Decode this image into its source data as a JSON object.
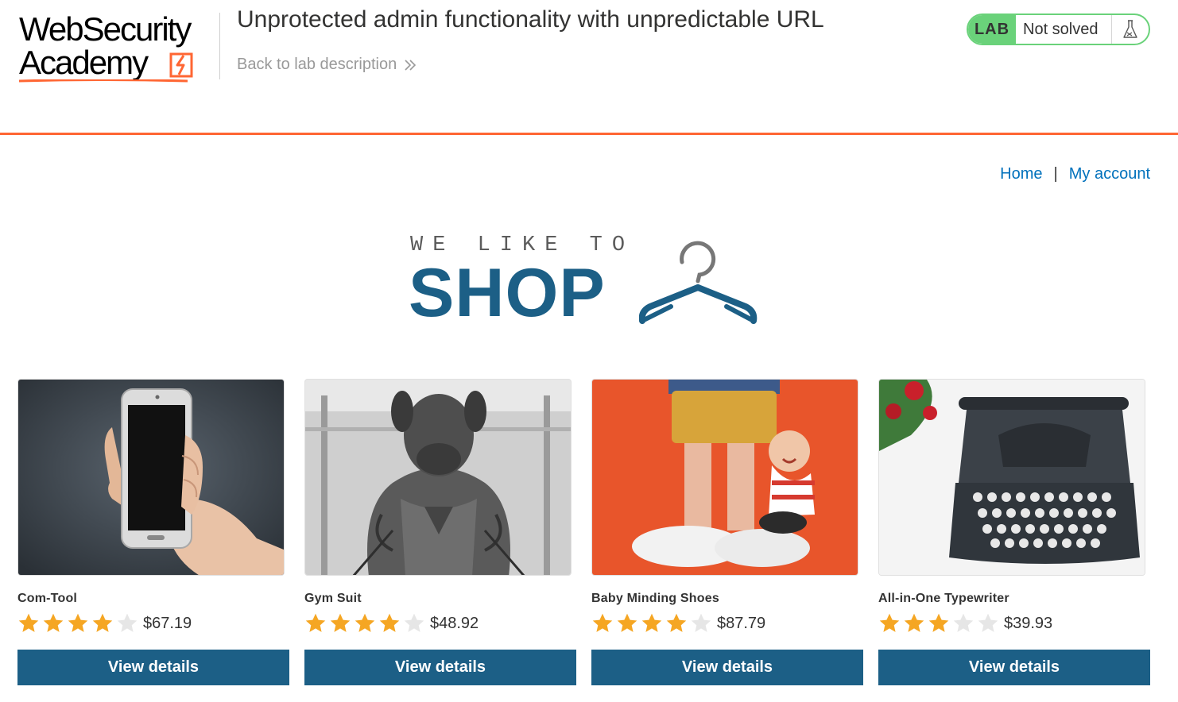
{
  "brand": {
    "line1": "WebSecurity",
    "line2": "Academy",
    "accent_color": "#ff6633"
  },
  "lab": {
    "title": "Unprotected admin functionality with unpredictable URL",
    "back_link": "Back to lab description",
    "tag": "LAB",
    "status": "Not solved",
    "status_color": "#6ad27a",
    "flask_icon": "flask-icon"
  },
  "nav": {
    "home": "Home",
    "separator": "|",
    "my_account": "My account"
  },
  "banner": {
    "small_text": "WE LIKE TO",
    "big_text": "SHOP",
    "icon": "hanger-icon",
    "color": "#1c5f86"
  },
  "products": [
    {
      "name": "Com-Tool",
      "rating": 4,
      "max_rating": 5,
      "price": "$67.19",
      "button": "View details",
      "image": "hand-holding-phone"
    },
    {
      "name": "Gym Suit",
      "rating": 4,
      "max_rating": 5,
      "price": "$48.92",
      "button": "View details",
      "image": "dog-head-bodybuilder"
    },
    {
      "name": "Baby Minding Shoes",
      "rating": 4,
      "max_rating": 5,
      "price": "$87.79",
      "button": "View details",
      "image": "figurine-with-baby"
    },
    {
      "name": "All-in-One Typewriter",
      "rating": 3,
      "max_rating": 5,
      "price": "$39.93",
      "button": "View details",
      "image": "typewriter-with-roses"
    }
  ],
  "colors": {
    "button": "#1c5f86",
    "link": "#0071bc",
    "star_filled": "#f5a623",
    "star_empty": "#e6e6e6"
  }
}
